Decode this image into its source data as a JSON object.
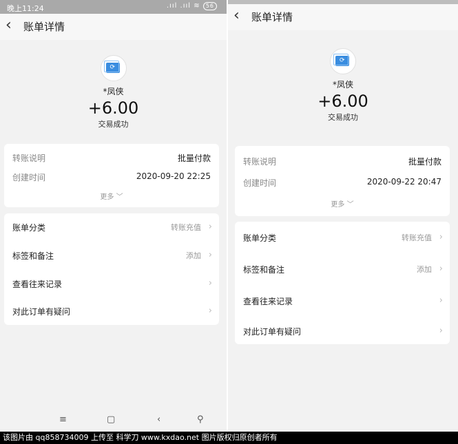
{
  "left": {
    "statusbar": {
      "time": "晚上11:24",
      "signals": ".ııl .ııl ≋",
      "battery": "56"
    },
    "navbar": {
      "back": "‹",
      "title": "账单详情"
    },
    "header": {
      "payer": "*凤侠",
      "amount": "+6.00",
      "status": "交易成功"
    },
    "details": {
      "rows": [
        {
          "label": "转账说明",
          "value": "批量付款"
        },
        {
          "label": "创建时间",
          "value": "2020-09-20 22:25"
        }
      ],
      "more": "更多 ﹀"
    },
    "menu": [
      {
        "label": "账单分类",
        "value": "转账充值"
      },
      {
        "label": "标签和备注",
        "value": "添加"
      },
      {
        "label": "查看往来记录",
        "value": ""
      },
      {
        "label": "对此订单有疑问",
        "value": ""
      }
    ],
    "bottom_nav": {
      "menu": "≡",
      "home": "▢",
      "back": "‹",
      "accessibility": "⚲"
    }
  },
  "right": {
    "navbar": {
      "back": "‹",
      "title": "账单详情"
    },
    "header": {
      "payer": "*凤侠",
      "amount": "+6.00",
      "status": "交易成功"
    },
    "details": {
      "rows": [
        {
          "label": "转账说明",
          "value": "批量付款"
        },
        {
          "label": "创建时间",
          "value": "2020-09-22 20:47"
        }
      ],
      "more": "更多 ﹀"
    },
    "menu": [
      {
        "label": "账单分类",
        "value": "转账充值"
      },
      {
        "label": "标签和备注",
        "value": "添加"
      },
      {
        "label": "查看往来记录",
        "value": ""
      },
      {
        "label": "对此订单有疑问",
        "value": ""
      }
    ]
  },
  "chevron": "›",
  "colors": {
    "accent": "#3a8de0",
    "background": "#f2f2f2",
    "card": "#ffffff"
  },
  "watermark": "该图片由 qq858734009 上传至 科学刀 www.kxdao.net 图片版权归原创者所有"
}
